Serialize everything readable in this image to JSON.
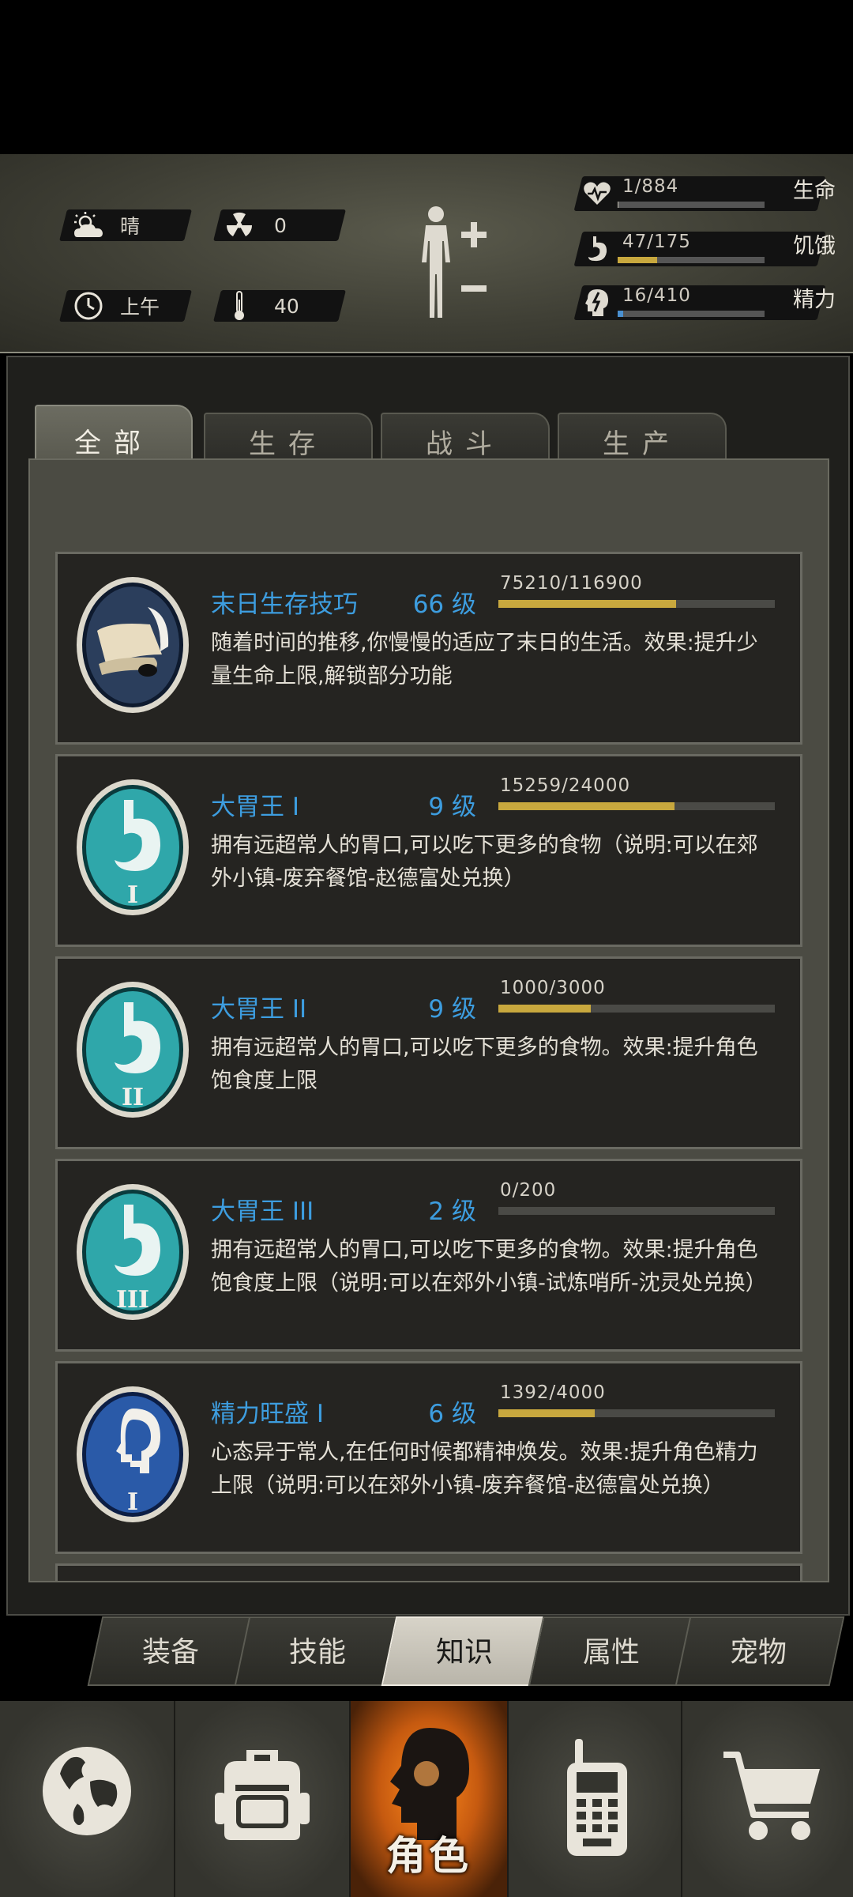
{
  "status": {
    "weather": {
      "label": "晴",
      "icon": "weather-cloud-icon"
    },
    "radiation": {
      "value": "0",
      "icon": "radiation-icon"
    },
    "time": {
      "label": "上午",
      "icon": "clock-icon"
    },
    "temperature": {
      "value": "40",
      "icon": "thermometer-icon"
    },
    "body_button_icon": "body-plus-minus-icon",
    "stats": [
      {
        "key": "health",
        "text": "1/884",
        "label": "生命",
        "icon": "heart-pulse-icon",
        "fraction": 0.001,
        "color": "#c8c4b8"
      },
      {
        "key": "hunger",
        "text": "47/175",
        "label": "饥饿",
        "icon": "stomach-icon",
        "fraction": 0.27,
        "color": "#c8a83e"
      },
      {
        "key": "energy",
        "text": "16/410",
        "label": "精力",
        "icon": "brain-lightning-icon",
        "fraction": 0.04,
        "color": "#4a90d0"
      }
    ]
  },
  "tabs": [
    {
      "label": "全部",
      "active": true
    },
    {
      "label": "生存",
      "active": false
    },
    {
      "label": "战斗",
      "active": false
    },
    {
      "label": "生产",
      "active": false
    }
  ],
  "skills": [
    {
      "name": "末日生存技巧",
      "level": "66 级",
      "progress_text": "75210/116900",
      "progress": 0.643,
      "desc": "随着时间的推移,你慢慢的适应了末日的生活。效果:提升少量生命上限,解锁部分功能",
      "icon": "scroll-quill-icon"
    },
    {
      "name": "大胃王 I",
      "level": "9 级",
      "progress_text": "15259/24000",
      "progress": 0.636,
      "desc": "拥有远超常人的胃口,可以吃下更多的食物（说明:可以在郊外小镇-废弃餐馆-赵德富处兑换）",
      "icon": "stomach-badge-icon",
      "numeral": "I"
    },
    {
      "name": "大胃王 II",
      "level": "9 级",
      "progress_text": "1000/3000",
      "progress": 0.333,
      "desc": "拥有远超常人的胃口,可以吃下更多的食物。效果:提升角色饱食度上限",
      "icon": "stomach-badge-icon",
      "numeral": "II"
    },
    {
      "name": "大胃王 III",
      "level": "2 级",
      "progress_text": "0/200",
      "progress": 0.0,
      "desc": "拥有远超常人的胃口,可以吃下更多的食物。效果:提升角色饱食度上限（说明:可以在郊外小镇-试炼哨所-沈灵处兑换）",
      "icon": "stomach-badge-icon",
      "numeral": "III"
    },
    {
      "name": "精力旺盛 I",
      "level": "6 级",
      "progress_text": "1392/4000",
      "progress": 0.348,
      "desc": "心态异于常人,在任何时候都精神焕发。效果:提升角色精力上限（说明:可以在郊外小镇-废弃餐馆-赵德富处兑换）",
      "icon": "head-badge-icon",
      "numeral": "I"
    }
  ],
  "subtabs": [
    {
      "label": "装备",
      "active": false
    },
    {
      "label": "技能",
      "active": false
    },
    {
      "label": "知识",
      "active": true
    },
    {
      "label": "属性",
      "active": false
    },
    {
      "label": "宠物",
      "active": false
    }
  ],
  "nav": [
    {
      "key": "world",
      "icon": "globe-icon",
      "label": "",
      "active": false
    },
    {
      "key": "bag",
      "icon": "backpack-icon",
      "label": "",
      "active": false
    },
    {
      "key": "character",
      "icon": "head-silhouette-icon",
      "label": "角色",
      "active": true
    },
    {
      "key": "radio",
      "icon": "walkie-talkie-icon",
      "label": "",
      "active": false
    },
    {
      "key": "shop",
      "icon": "cart-icon",
      "label": "",
      "active": false
    }
  ]
}
